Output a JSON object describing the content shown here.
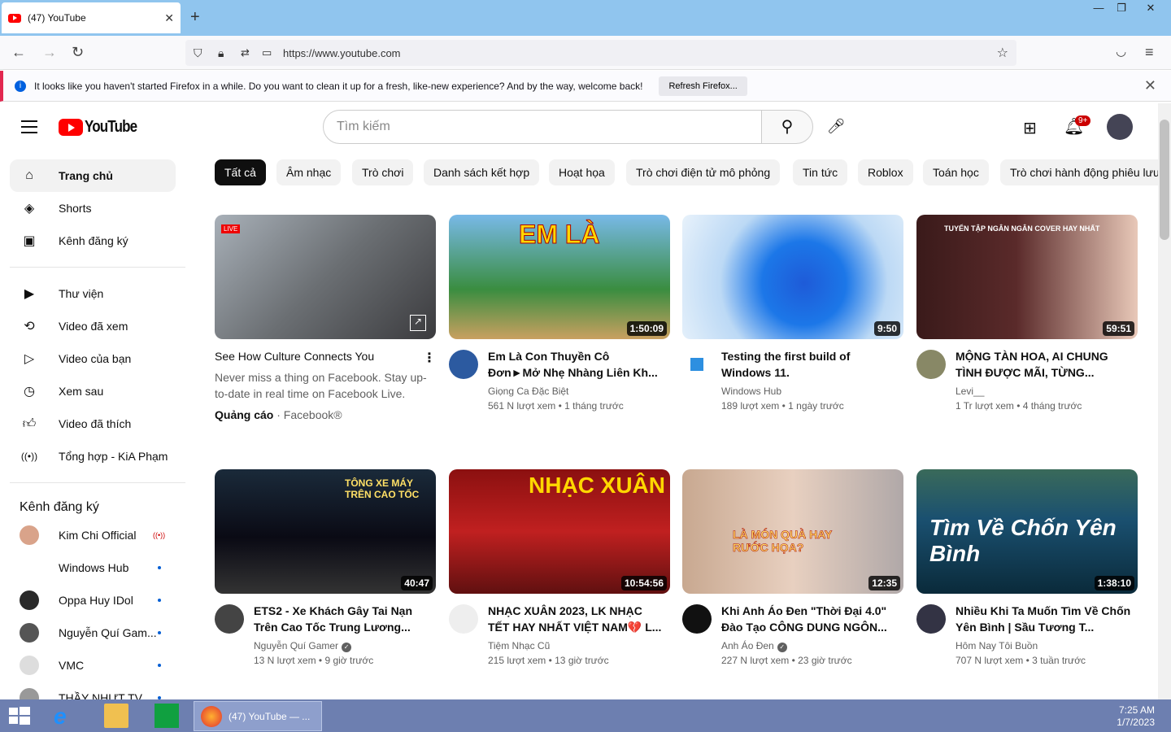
{
  "browser": {
    "tab_title": "(47) YouTube",
    "url": "https://www.youtube.com",
    "notification": "It looks like you haven't started Firefox in a while. Do you want to clean it up for a fresh, like-new experience? And by the way, welcome back!",
    "refresh_button": "Refresh Firefox..."
  },
  "header": {
    "logo_text": "YouTube",
    "search_placeholder": "Tìm kiếm",
    "notification_count": "9+"
  },
  "sidebar": {
    "items": [
      {
        "label": "Trang chủ",
        "icon": "home-icon"
      },
      {
        "label": "Shorts",
        "icon": "shorts-icon"
      },
      {
        "label": "Kênh đăng ký",
        "icon": "subscriptions-icon"
      },
      {
        "label": "Thư viện",
        "icon": "library-icon"
      },
      {
        "label": "Video đã xem",
        "icon": "history-icon"
      },
      {
        "label": "Video của bạn",
        "icon": "your-videos-icon"
      },
      {
        "label": "Xem sau",
        "icon": "watch-later-icon"
      },
      {
        "label": "Video đã thích",
        "icon": "liked-icon"
      },
      {
        "label": "Tổng hợp - KiA Phạm",
        "icon": "playlist-icon"
      }
    ],
    "subscriptions_heading": "Kênh đăng ký",
    "subscriptions": [
      {
        "name": "Kim Chi Official"
      },
      {
        "name": "Windows Hub"
      },
      {
        "name": "Oppa Huy IDol"
      },
      {
        "name": "Nguyễn Quí Gam..."
      },
      {
        "name": "VMC"
      },
      {
        "name": "THẦY NHỰT TV"
      }
    ]
  },
  "chips": [
    "Tất cả",
    "Âm nhạc",
    "Trò chơi",
    "Danh sách kết hợp",
    "Hoạt họa",
    "Trò chơi điện tử mô phỏng",
    "Tin tức",
    "Roblox",
    "Toán học",
    "Trò chơi hành động phiêu lưu"
  ],
  "videos": [
    {
      "title": "See How Culture Connects You",
      "desc": "Never miss a thing on Facebook. Stay up-to-date in real time on Facebook Live.",
      "ad_label": "Quảng cáo",
      "ad_source": "· Facebook®",
      "duration": ""
    },
    {
      "title": "Em Là Con Thuyền Cô Đơn►Mở Nhẹ Nhàng Liên Kh...",
      "channel": "Giọng Ca Đặc Biệt",
      "meta": "561 N lượt xem • 1 tháng trước",
      "duration": "1:50:09",
      "thumb_text": "EM LÀ"
    },
    {
      "title": "Testing the first build of Windows 11.",
      "channel": "Windows Hub",
      "meta": "189 lượt xem • 1 ngày trước",
      "duration": "9:50"
    },
    {
      "title": "MỘNG TÀN HOA, AI CHUNG TÌNH ĐƯỢC MÃI, TỪNG...",
      "channel": "Levi__",
      "meta": "1 Tr lượt xem • 4 tháng trước",
      "duration": "59:51",
      "thumb_text": "TUYỂN TẬP NGÂN NGÂN COVER HAY NHẤT"
    },
    {
      "title": "ETS2 - Xe Khách Gây Tai Nạn Trên Cao Tốc Trung Lương...",
      "channel": "Nguyễn Quí Gamer",
      "meta": "13 N lượt xem • 9 giờ trước",
      "duration": "40:47",
      "thumb_text": "TÔNG XE MÁY TRÊN CAO TỐC"
    },
    {
      "title": "NHẠC XUÂN 2023, LK NHẠC TẾT HAY NHẤT VIỆT NAM💔 L...",
      "channel": "Tiệm Nhạc Cũ",
      "meta": "215 lượt xem • 13 giờ trước",
      "duration": "10:54:56",
      "thumb_text": "NHẠC XUÂN"
    },
    {
      "title": "Khi Anh Áo Đen \"Thời Đại 4.0\" Đào Tạo CÔNG DUNG NGÔN...",
      "channel": "Anh Áo Đen",
      "meta": "227 N lượt xem • 23 giờ trước",
      "duration": "12:35",
      "thumb_text": "LÀ MÓN QUÀ HAY RƯỚC HỌA?"
    },
    {
      "title": "Nhiều Khi Ta Muốn Tìm Về Chốn Yên Bình | Sầu Tương T...",
      "channel": "Hôm Nay Tôi Buồn",
      "meta": "707 N lượt xem • 3 tuần trước",
      "duration": "1:38:10",
      "thumb_text": "Tìm Về Chốn Yên Bình"
    }
  ],
  "taskbar": {
    "task_label": "(47) YouTube — ...",
    "time": "7:25 AM",
    "date": "1/7/2023"
  }
}
